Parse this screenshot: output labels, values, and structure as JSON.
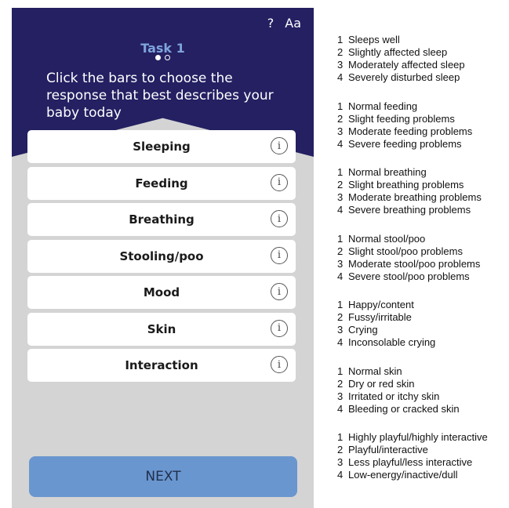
{
  "header": {
    "help_label": "?",
    "text_size_label": "Aa",
    "task_title": "Task 1",
    "instructions": "Click the bars to choose the response that best describes your baby today"
  },
  "bars": [
    {
      "label": "Sleeping"
    },
    {
      "label": "Feeding"
    },
    {
      "label": "Breathing"
    },
    {
      "label": "Stooling/poo"
    },
    {
      "label": "Mood"
    },
    {
      "label": "Skin"
    },
    {
      "label": "Interaction"
    }
  ],
  "info_icon_glyph": "i",
  "next_label": "NEXT",
  "legend": [
    [
      "Sleeps well",
      "Slightly affected sleep",
      "Moderately affected sleep",
      "Severely disturbed sleep"
    ],
    [
      "Normal feeding",
      "Slight feeding problems",
      "Moderate feeding problems",
      "Severe feeding problems"
    ],
    [
      "Normal breathing",
      "Slight breathing problems",
      "Moderate breathing problems",
      "Severe breathing problems"
    ],
    [
      "Normal stool/poo",
      "Slight stool/poo problems",
      "Moderate stool/poo problems",
      "Severe stool/poo problems"
    ],
    [
      "Happy/content",
      "Fussy/irritable",
      "Crying",
      "Inconsolable crying"
    ],
    [
      "Normal skin",
      "Dry or red skin",
      "Irritated or itchy skin",
      "Bleeding or cracked skin"
    ],
    [
      "Highly playful/highly interactive",
      "Playful/interactive",
      "Less playful/less interactive",
      "Low-energy/inactive/dull"
    ]
  ],
  "colors": {
    "header_bg": "#242062",
    "panel_bg": "#d4d4d4",
    "task_title": "#7fa4dc",
    "next_button": "#6a96cf"
  }
}
